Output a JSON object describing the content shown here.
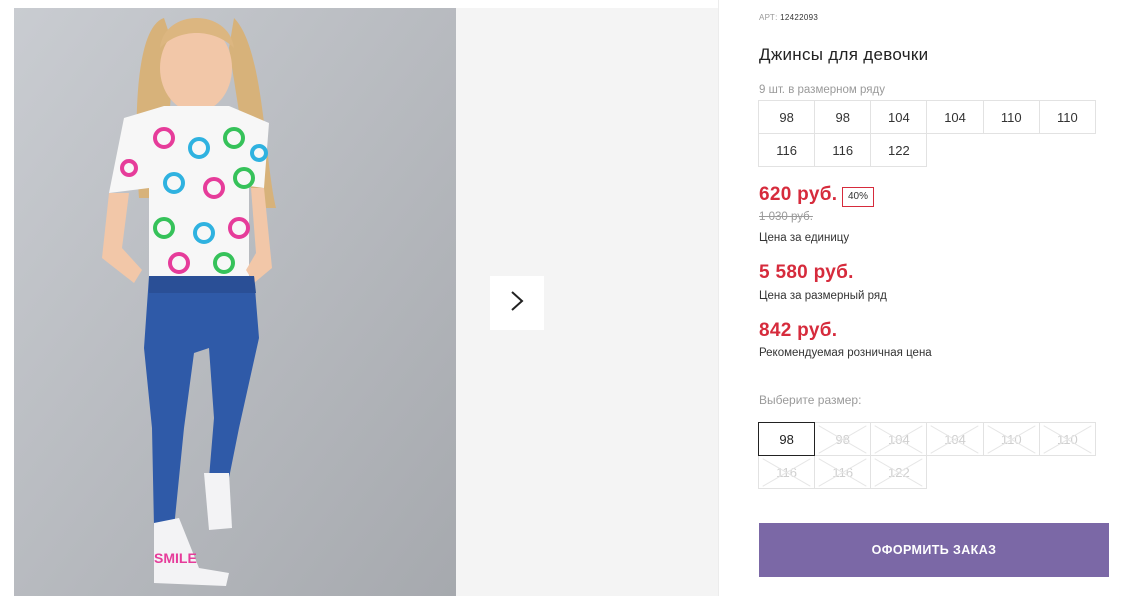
{
  "product": {
    "art_label": "АРТ:",
    "art_value": "12422093",
    "title": "Джинсы для девочки",
    "size_row_note": "9 шт. в размерном ряду",
    "size_row": [
      "98",
      "98",
      "104",
      "104",
      "110",
      "110",
      "116",
      "116",
      "122"
    ]
  },
  "pricing": {
    "unit_price": "620 руб.",
    "discount": "40%",
    "old_price": "1 030 руб.",
    "unit_price_label": "Цена за единицу",
    "row_price": "5 580 руб.",
    "row_price_label": "Цена за размерный ряд",
    "retail_price": "842 руб.",
    "retail_price_label": "Рекомендуемая розничная цена"
  },
  "size_select": {
    "label": "Выберите размер:",
    "options": [
      {
        "label": "98",
        "state": "selected"
      },
      {
        "label": "98",
        "state": "disabled"
      },
      {
        "label": "104",
        "state": "disabled"
      },
      {
        "label": "104",
        "state": "disabled"
      },
      {
        "label": "110",
        "state": "disabled"
      },
      {
        "label": "110",
        "state": "disabled"
      },
      {
        "label": "116",
        "state": "disabled"
      },
      {
        "label": "116",
        "state": "disabled"
      },
      {
        "label": "122",
        "state": "disabled"
      }
    ]
  },
  "actions": {
    "order_label": "ОФОРМИТЬ ЗАКАЗ",
    "next_icon": "chevron-right-icon"
  },
  "colors": {
    "price_red": "#d62b3c",
    "order_button": "#7b68a6",
    "gallery_bg": "#f4f4f4"
  }
}
